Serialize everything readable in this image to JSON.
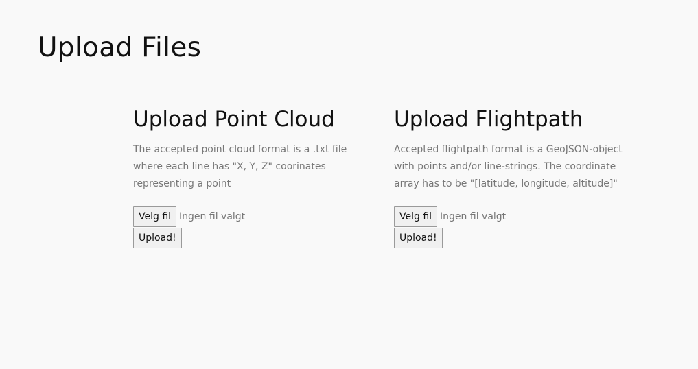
{
  "page": {
    "title": "Upload Files"
  },
  "point_cloud": {
    "heading": "Upload Point Cloud",
    "description": "The accepted point cloud format is a .txt file where each line has \"X, Y, Z\" coorinates representing a point",
    "choose_file_label": "Velg fil",
    "file_status": "Ingen fil valgt",
    "upload_label": "Upload!"
  },
  "flightpath": {
    "heading": "Upload Flightpath",
    "description": "Accepted flightpath format is a GeoJSON-object with points and/or line-strings. The coordinate array has to be \"[latitude, longitude, altitude]\"",
    "choose_file_label": "Velg fil",
    "file_status": "Ingen fil valgt",
    "upload_label": "Upload!"
  },
  "colors": {
    "background": "#f9f9f9",
    "heading_text": "#111111",
    "muted_text": "#777777",
    "button_border": "#9a9a9a",
    "button_background": "#f0f0f0"
  }
}
